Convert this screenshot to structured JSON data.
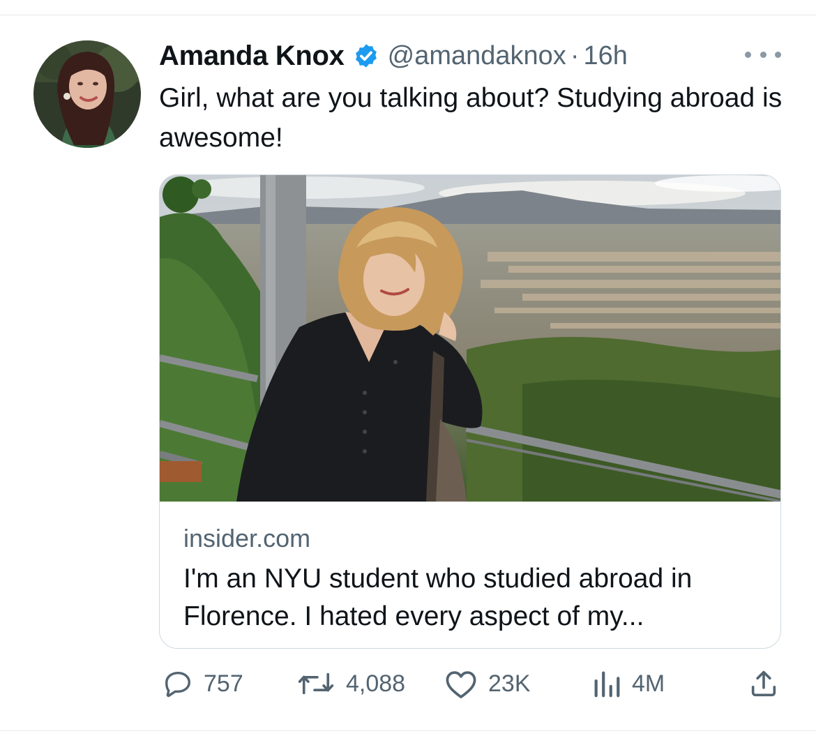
{
  "author": {
    "name": "Amanda Knox",
    "handle": "@amandaknox",
    "separator": "·",
    "timestamp": "16h",
    "verified": true,
    "verified_color": "#1d9bf0"
  },
  "tweet": {
    "text": "Girl, what are you talking about? Studying abroad is awesome!"
  },
  "link_card": {
    "domain": "insider.com",
    "title": "I'm an NYU student who studied abroad in Florence. I hated every aspect of my..."
  },
  "actions": {
    "replies": "757",
    "retweets": "4,088",
    "likes": "23K",
    "views": "4M"
  },
  "icons": {
    "reply": "reply-icon",
    "retweet": "retweet-icon",
    "like": "heart-icon",
    "views": "views-icon",
    "share": "share-icon",
    "more": "more-icon",
    "verified": "verified-badge-icon"
  },
  "colors": {
    "text": "#0f1419",
    "secondary": "#536471",
    "border": "#cfd9de"
  }
}
